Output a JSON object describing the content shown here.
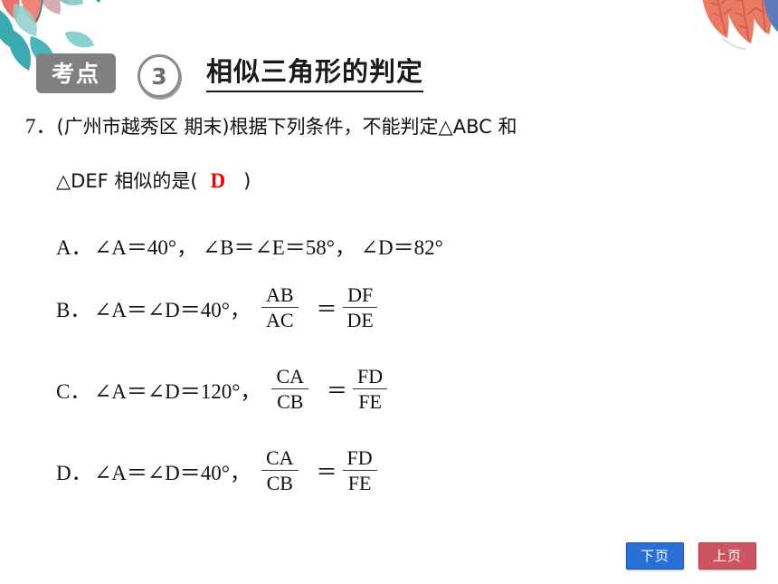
{
  "header": {
    "badge_label": "考点",
    "number": "3",
    "title": "相似三角形的判定",
    "badge_color": "#808080",
    "circle_color": "#8a8a8a"
  },
  "question": {
    "number": "7．",
    "source": "(广州市越秀区 期末)",
    "line1_text": "根据下列条件，不能判定△ABC 和",
    "line2_prefix": "△DEF 相似的是(",
    "answer": "D",
    "answer_color": "#ee0000",
    "line2_suffix": ")"
  },
  "options": [
    {
      "label": "A．",
      "condition": "∠A＝40°，  ∠B＝∠E＝58°，  ∠D＝82°",
      "has_fraction": false,
      "comma": ""
    },
    {
      "label": "B．",
      "condition": "∠A＝∠D＝40°",
      "comma": "，",
      "has_fraction": true,
      "left_num": "AB",
      "left_den": "AC",
      "equals": "＝",
      "right_num": "DF",
      "right_den": "DE"
    },
    {
      "label": "C．",
      "condition": "∠A＝∠D＝120°",
      "comma": "，",
      "has_fraction": true,
      "left_num": "CA",
      "left_den": "CB",
      "equals": "＝",
      "right_num": "FD",
      "right_den": "FE"
    },
    {
      "label": "D．",
      "condition": "∠A＝∠D＝40°",
      "comma": "，",
      "has_fraction": true,
      "left_num": "CA",
      "left_den": "CB",
      "equals": "＝",
      "right_num": "FD",
      "right_den": "FE"
    }
  ],
  "nav": {
    "next_label": "下页",
    "prev_label": "上页",
    "next_color": "#2a6fd6",
    "prev_color": "#cb5560"
  }
}
